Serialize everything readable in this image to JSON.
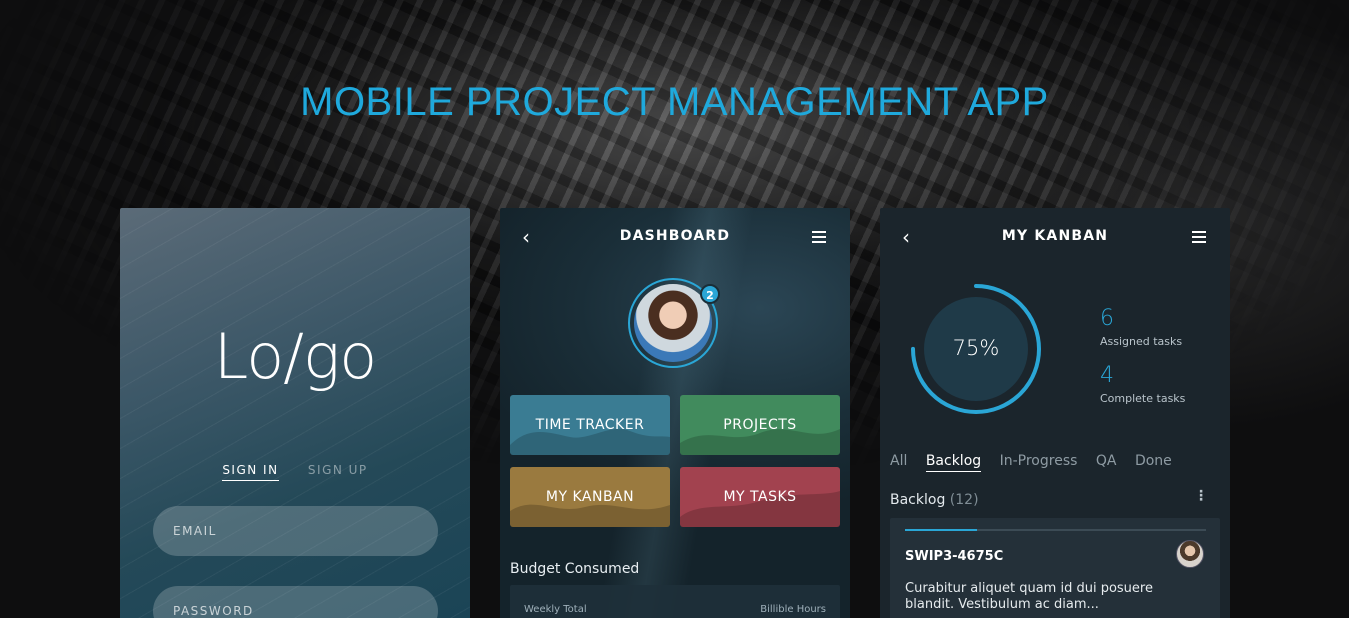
{
  "page": {
    "headline": "MOBILE PROJECT MANAGEMENT APP"
  },
  "login": {
    "logo": "Lo/go",
    "tabs": [
      "SIGN IN",
      "SIGN UP"
    ],
    "email_placeholder": "EMAIL",
    "password_placeholder": "PASSWORD"
  },
  "dashboard": {
    "title": "DASHBOARD",
    "back_icon": "chevron-left-icon",
    "menu_icon": "hamburger-icon",
    "notification_count": "2",
    "tiles": [
      {
        "label": "TIME TRACKER",
        "color": "#3a7c93"
      },
      {
        "label": "PROJECTS",
        "color": "#418b5d"
      },
      {
        "label": "MY KANBAN",
        "color": "#9a7a3f"
      },
      {
        "label": "MY TASKS",
        "color": "#a2424f"
      }
    ],
    "budget_title": "Budget Consumed",
    "budget_left": "Weekly Total",
    "budget_right": "Billible Hours"
  },
  "kanban": {
    "title": "MY KANBAN",
    "progress_label": "75%",
    "progress_value": 0.75,
    "assigned_count": "6",
    "assigned_label": "Assigned tasks",
    "complete_count": "4",
    "complete_label": "Complete tasks",
    "tabs": [
      "All",
      "Backlog",
      "In-Progress",
      "QA",
      "Done"
    ],
    "active_tab": "Backlog",
    "section_title": "Backlog",
    "section_count": "(12)",
    "task": {
      "id": "SWIP3-4675C",
      "description": "Curabitur aliquet quam id dui posuere blandit. Vestibulum ac diam...",
      "progress": 0.24
    }
  },
  "colors": {
    "accent": "#2aa6d6"
  }
}
